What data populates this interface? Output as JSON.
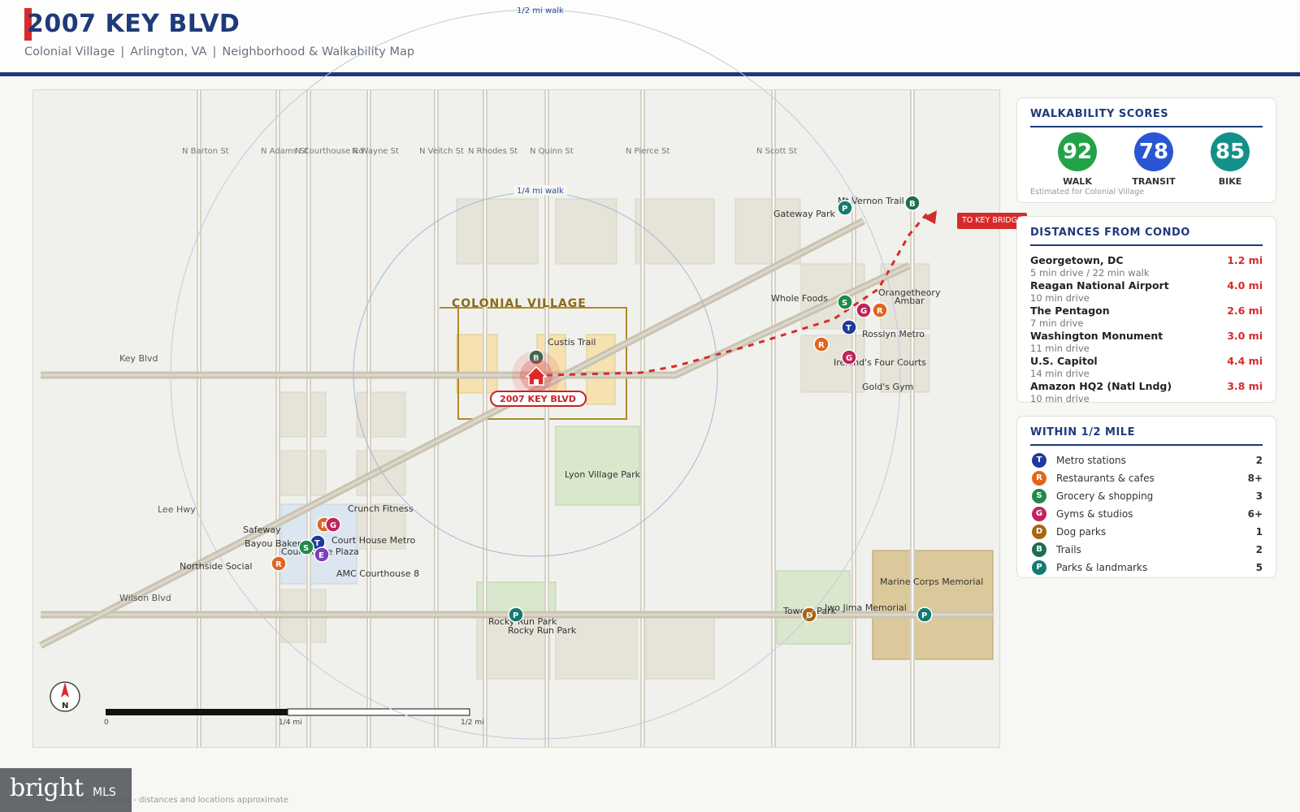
{
  "header": {
    "title": "2007 KEY BLVD",
    "subtitle_parts": [
      "Colonial Village",
      "Arlington, VA",
      "Neighborhood & Walkability Map"
    ],
    "separator": "|"
  },
  "map": {
    "streets_ns": [
      "N Barton St",
      "N Adams St",
      "N Courthouse Rd",
      "N Wayne St",
      "N Veitch St",
      "N Rhodes St",
      "N Quinn St",
      "N Pierce St",
      "N Scott St"
    ],
    "roads": {
      "key_blvd": "Key Blvd",
      "lee_hwy": "Lee Hwy",
      "wilson_blvd": "Wilson Blvd"
    },
    "neighborhood_label": "COLONIAL VILLAGE",
    "property_label": "2007 KEY BLVD",
    "ring_labels": {
      "quarter": "1/4 mi walk",
      "half": "1/2 mi walk"
    },
    "callout": "TO KEY BRIDGE",
    "places": {
      "custis_trail": "Custis Trail",
      "lyon_village_park": "Lyon Village Park",
      "gateway_park": "Gateway Park",
      "mt_vernon_trail": "Mt Vernon Trail",
      "whole_foods": "Whole Foods",
      "orangetheory": "Orangetheory",
      "ambar": "Ambar",
      "rosslyn_metro": "Rosslyn Metro",
      "irelands_four_courts": "Ireland's Four Courts",
      "golds_gym": "Gold's Gym",
      "crunch_fitness": "Crunch Fitness",
      "safeway": "Safeway",
      "bayou_bakery": "Bayou Bakery",
      "court_house_metro": "Court House Metro",
      "courthouse_plaza": "Courthouse Plaza",
      "northside_social": "Northside Social",
      "amc_courthouse_8": "AMC Courthouse 8",
      "rocky_run_park": "Rocky Run Park",
      "rocky_run_park_faded": "Rocky Run Park",
      "iwo_jima_memorial": "Iwo Jima Memorial",
      "towers_park": "Towers Park",
      "marine_corps_memorial": "Marine Corps Memorial"
    },
    "scale": {
      "zero": "0",
      "quarter": "1/4 mi",
      "half": "1/2 mi"
    },
    "compass": "N"
  },
  "walkability": {
    "title": "WALKABILITY SCORES",
    "scores": [
      {
        "label": "WALK",
        "value": "92",
        "color": "#22a34a"
      },
      {
        "label": "TRANSIT",
        "value": "78",
        "color": "#2a55d4"
      },
      {
        "label": "BIKE",
        "value": "85",
        "color": "#14908a"
      }
    ],
    "note": "Estimated for Colonial Village"
  },
  "distances": {
    "title": "DISTANCES FROM CONDO",
    "items": [
      {
        "name": "Georgetown, DC",
        "detail": "5 min drive / 22 min walk",
        "value": "1.2 mi"
      },
      {
        "name": "Reagan National Airport",
        "detail": "10 min drive",
        "value": "4.0 mi"
      },
      {
        "name": "The Pentagon",
        "detail": "7 min drive",
        "value": "2.6 mi"
      },
      {
        "name": "Washington Monument",
        "detail": "11 min drive",
        "value": "3.0 mi"
      },
      {
        "name": "U.S. Capitol",
        "detail": "14 min drive",
        "value": "4.4 mi"
      },
      {
        "name": "Amazon HQ2 (Natl Lndg)",
        "detail": "10 min drive",
        "value": "3.8 mi"
      }
    ]
  },
  "within": {
    "title": "WITHIN 1/2 MILE",
    "items": [
      {
        "letter": "T",
        "color": "#1f3a9b",
        "name": "Metro stations",
        "count": "2"
      },
      {
        "letter": "R",
        "color": "#e0661c",
        "name": "Restaurants & cafes",
        "count": "8+"
      },
      {
        "letter": "S",
        "color": "#1f8a4a",
        "name": "Grocery & shopping",
        "count": "3"
      },
      {
        "letter": "G",
        "color": "#c0245a",
        "name": "Gyms & studios",
        "count": "6+"
      },
      {
        "letter": "D",
        "color": "#a86410",
        "name": "Dog parks",
        "count": "1"
      },
      {
        "letter": "B",
        "color": "#1e6e52",
        "name": "Trails",
        "count": "2"
      },
      {
        "letter": "P",
        "color": "#157a70",
        "name": "Parks & landmarks",
        "count": "5"
      }
    ]
  },
  "footer": {
    "brand": "bright",
    "brand_suffix": "MLS",
    "disclaimer": "For illustration purposes - distances and locations approximate"
  },
  "colors": {
    "navy": "#1f3a7a",
    "accent_red": "#d62b2b",
    "map_bg": "#f0f1ec",
    "road": "#c9c3b3"
  }
}
